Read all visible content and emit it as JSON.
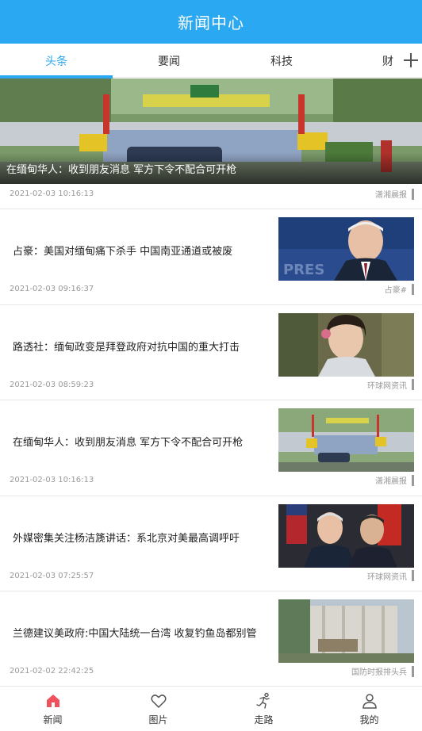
{
  "header": {
    "title": "新闻中心"
  },
  "tabs": [
    {
      "label": "头条",
      "active": true
    },
    {
      "label": "要闻",
      "active": false
    },
    {
      "label": "科技",
      "active": false
    },
    {
      "label": "财",
      "active": false
    }
  ],
  "hero": {
    "caption": "在缅甸华人：收到朋友消息 军方下令不配合可开枪",
    "time": "2021-02-03 10:16:13",
    "source": "潇湘晨报"
  },
  "items": [
    {
      "title": "占豪：美国对缅甸痛下杀手 中国南亚通道或被废",
      "time": "2021-02-03 09:16:37",
      "source": "占豪#"
    },
    {
      "title": "路透社：缅甸政变是拜登政府对抗中国的重大打击",
      "time": "2021-02-03 08:59:23",
      "source": "环球网资讯"
    },
    {
      "title": "在缅甸华人：收到朋友消息 军方下令不配合可开枪",
      "time": "2021-02-03 10:16:13",
      "source": "潇湘晨报"
    },
    {
      "title": "外媒密集关注杨洁篪讲话：系北京对美最高调呼吁",
      "time": "2021-02-03 07:25:57",
      "source": "环球网资讯"
    },
    {
      "title": "兰德建议美政府:中国大陆统一台湾 收复钓鱼岛都别管",
      "time": "2021-02-02 22:42:25",
      "source": "国防时报排头兵"
    }
  ],
  "tabbar": [
    {
      "label": "新闻",
      "icon": "home-icon",
      "active": true
    },
    {
      "label": "图片",
      "icon": "heart-icon",
      "active": false
    },
    {
      "label": "走路",
      "icon": "runner-icon",
      "active": false
    },
    {
      "label": "我的",
      "icon": "user-icon",
      "active": false
    }
  ],
  "colors": {
    "accent": "#2aa8f2",
    "active_icon": "#f0525d"
  }
}
